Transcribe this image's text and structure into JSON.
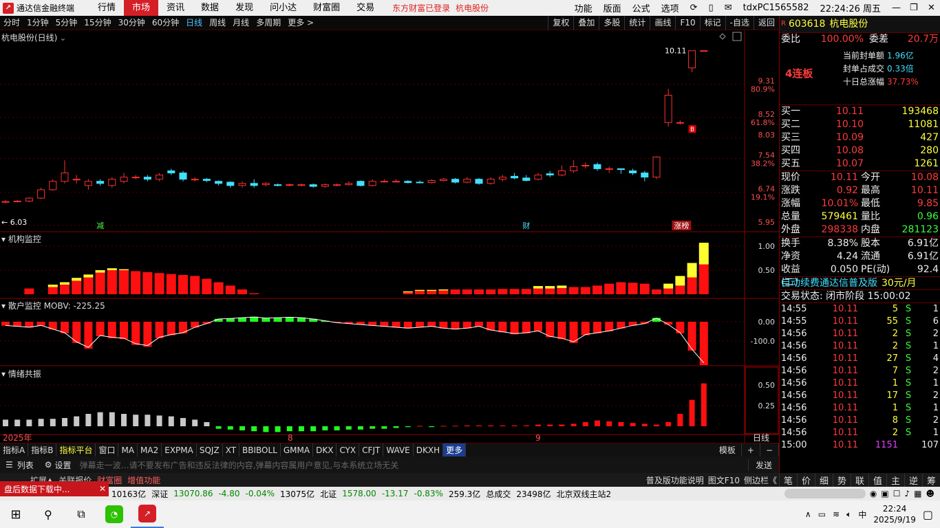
{
  "titlebar": {
    "app": "通达信金融终端",
    "menus": [
      "行情",
      "市场",
      "资讯",
      "数据",
      "发现",
      "问小达",
      "财富圈",
      "交易"
    ],
    "active_menu": "市场",
    "notice1": "东方财富已登录",
    "notice2": "杭电股份",
    "right_menus": [
      "功能",
      "版面",
      "公式",
      "选项"
    ],
    "account": "tdxPC1565582",
    "time": "22:24:26 周五"
  },
  "periods": [
    "分时",
    "1分钟",
    "5分钟",
    "15分钟",
    "30分钟",
    "60分钟",
    "日线",
    "周线",
    "月线",
    "多周期",
    "更多 >"
  ],
  "active_period": "日线",
  "toolbtns": [
    "复权",
    "叠加",
    "多股",
    "统计",
    "画线",
    "F10",
    "标记",
    "-自选",
    "返回"
  ],
  "chart": {
    "title": "杭电股份(日线)",
    "high_label": "10.11",
    "low_label": "← 6.03",
    "axis_prices": [
      "9.31",
      "8.52",
      "8.03",
      "7.54",
      "6.74",
      "5.95"
    ],
    "axis_pcts": [
      "80.9%",
      "61.8%",
      "38.2%",
      "19.1%"
    ],
    "markers": {
      "jian": "减",
      "cai": "财",
      "zhangbang": "涨榜",
      "b": "B"
    }
  },
  "panels": {
    "jigou": {
      "label": "机构监控",
      "ticks": [
        "1.00",
        "0.50"
      ]
    },
    "sanhu": {
      "label": "散户监控",
      "value": "MOBV: -225.25",
      "ticks": [
        "0.00",
        "-100.0"
      ]
    },
    "qingxu": {
      "label": "情绪共振",
      "ticks": [
        "0.50",
        "0.25"
      ]
    }
  },
  "xaxis": {
    "year": "2025年",
    "m8": "8",
    "m9": "9",
    "period": "日线"
  },
  "chart_data": {
    "type": "candlestick",
    "candles": [
      [
        6.5,
        6.52,
        6.55,
        6.48
      ],
      [
        6.52,
        6.53,
        6.56,
        6.5
      ],
      [
        6.53,
        6.6,
        6.62,
        6.5
      ],
      [
        6.6,
        6.8,
        6.85,
        6.58
      ],
      [
        6.8,
        7.0,
        7.05,
        6.78
      ],
      [
        7.0,
        7.2,
        7.5,
        6.95
      ],
      [
        7.05,
        7.05,
        7.15,
        6.95
      ],
      [
        6.9,
        7.0,
        7.05,
        6.8
      ],
      [
        7.0,
        6.95,
        7.05,
        6.9
      ],
      [
        6.9,
        7.05,
        7.1,
        6.85
      ],
      [
        7.0,
        7.1,
        7.2,
        6.95
      ],
      [
        7.1,
        7.1,
        7.15,
        7.05
      ],
      [
        7.1,
        7.05,
        7.15,
        7.0
      ],
      [
        7.05,
        7.15,
        7.2,
        7.0
      ],
      [
        7.25,
        7.2,
        7.3,
        7.15
      ],
      [
        7.2,
        7.05,
        7.25,
        7.0
      ],
      [
        7.05,
        7.05,
        7.1,
        7.0
      ],
      [
        7.05,
        7.02,
        7.08,
        6.98
      ],
      [
        7.0,
        6.95,
        7.02,
        6.9
      ],
      [
        6.98,
        6.9,
        7.0,
        6.85
      ],
      [
        6.9,
        6.95,
        7.0,
        6.85
      ],
      [
        6.95,
        6.9,
        7.05,
        6.85
      ],
      [
        6.92,
        6.95,
        6.98,
        6.88
      ],
      [
        6.92,
        6.9,
        6.95,
        6.88
      ],
      [
        6.92,
        6.92,
        6.95,
        6.88
      ],
      [
        6.9,
        6.92,
        6.95,
        6.88
      ],
      [
        6.92,
        6.88,
        6.95,
        6.85
      ],
      [
        6.88,
        6.92,
        6.95,
        6.85
      ],
      [
        6.9,
        6.92,
        6.95,
        6.88
      ],
      [
        6.92,
        6.95,
        7.0,
        6.9
      ],
      [
        7.0,
        6.9,
        7.02,
        6.88
      ],
      [
        6.9,
        7.0,
        7.05,
        6.88
      ],
      [
        7.0,
        7.0,
        7.05,
        6.98
      ],
      [
        7.0,
        7.0,
        7.05,
        6.98
      ],
      [
        7.0,
        6.97,
        7.03,
        6.95
      ],
      [
        6.98,
        6.97,
        7.02,
        6.95
      ],
      [
        6.97,
        7.02,
        7.05,
        6.95
      ],
      [
        7.02,
        7.05,
        7.08,
        7.0
      ],
      [
        7.05,
        6.98,
        7.08,
        6.95
      ],
      [
        6.98,
        7.05,
        7.1,
        6.95
      ],
      [
        7.05,
        6.95,
        7.08,
        6.92
      ],
      [
        6.95,
        7.05,
        7.1,
        6.92
      ],
      [
        7.05,
        7.1,
        7.15,
        7.0
      ],
      [
        7.12,
        7.08,
        7.2,
        7.05
      ],
      [
        7.08,
        7.02,
        7.15,
        7.0
      ],
      [
        7.05,
        7.15,
        7.2,
        7.02
      ],
      [
        7.18,
        7.15,
        7.25,
        7.1
      ],
      [
        7.15,
        7.25,
        7.38,
        7.12
      ],
      [
        7.25,
        7.35,
        7.5,
        7.2
      ],
      [
        7.38,
        7.38,
        7.45,
        7.3
      ],
      [
        7.4,
        7.3,
        7.45,
        7.25
      ],
      [
        7.3,
        7.3,
        7.35,
        7.2
      ],
      [
        7.3,
        7.28,
        7.3,
        7.18
      ],
      [
        7.25,
        7.2,
        7.3,
        7.15
      ],
      [
        7.2,
        7.1,
        7.25,
        7.0
      ],
      [
        7.1,
        7.58,
        7.6,
        7.05
      ],
      [
        8.4,
        9.05,
        9.2,
        8.3
      ],
      [
        8.4,
        8.4,
        8.45,
        8.35
      ],
      [
        9.7,
        10.11,
        10.11,
        9.6
      ],
      [
        10.11,
        10.11,
        10.11,
        10.11
      ]
    ],
    "jigou": {
      "red": [
        0,
        0,
        0.12,
        0,
        0.15,
        0.2,
        0.28,
        0.35,
        0.45,
        0.5,
        0.5,
        0.48,
        0.46,
        0.44,
        0.42,
        0.4,
        0.38,
        0.32,
        0.25,
        0.18,
        0.1,
        0.02,
        0,
        0,
        0,
        0,
        0,
        0,
        0,
        0,
        0,
        0,
        0,
        0,
        0.04,
        0.07,
        0.07,
        0.08,
        0.1,
        0.1,
        0.1,
        0.1,
        0.11,
        0.11,
        0.11,
        0.12,
        0.12,
        0.13,
        0.15,
        0.15,
        0.18,
        0.22,
        0.25,
        0.24,
        0.22,
        0.1,
        0.12,
        0.18,
        0.35,
        0.62
      ],
      "yellow": [
        0,
        0,
        0,
        0,
        0.05,
        0.05,
        0.06,
        0.06,
        0.05,
        0.04,
        0.02,
        0,
        0,
        0,
        0,
        0,
        0,
        0,
        0,
        0,
        0,
        0,
        0,
        0,
        0,
        0,
        0,
        0,
        0,
        0,
        0,
        0,
        0,
        0,
        0.02,
        0.02,
        0.02,
        0.02,
        0,
        0,
        0,
        0,
        0,
        0,
        0,
        0.05,
        0.05,
        0.05,
        0,
        0,
        0,
        0,
        0,
        0,
        0,
        0,
        0.1,
        0.2,
        0.3,
        0.45
      ]
    },
    "sanhu": [
      -20,
      -25,
      -30,
      -20,
      -40,
      -60,
      -110,
      -140,
      -75,
      -85,
      -90,
      -120,
      -130,
      -85,
      -70,
      -60,
      -30,
      -10,
      15,
      18,
      22,
      26,
      20,
      22,
      25,
      22,
      15,
      5,
      -5,
      -10,
      -15,
      -20,
      -25,
      -30,
      -35,
      -30,
      -25,
      -35,
      -40,
      -35,
      -25,
      -45,
      -55,
      -65,
      -60,
      -50,
      -80,
      -90,
      -110,
      -70,
      -60,
      -50,
      -35,
      -20,
      -10,
      20,
      -15,
      -60,
      -150,
      -225
    ],
    "qingxu": [
      0.08,
      0.08,
      0.08,
      0.09,
      0.09,
      0.1,
      0.12,
      0.15,
      0.17,
      0.17,
      0.15,
      0.14,
      0.14,
      0.13,
      0.12,
      0.1,
      0.08,
      0.05,
      -0.03,
      -0.04,
      -0.05,
      -0.06,
      -0.07,
      -0.07,
      -0.06,
      -0.06,
      -0.06,
      -0.05,
      -0.05,
      -0.04,
      -0.04,
      -0.03,
      -0.03,
      -0.02,
      -0.01,
      0.005,
      -0.01,
      0.005,
      0.005,
      0.01,
      0.01,
      0.01,
      0.01,
      0.01,
      0.01,
      0.02,
      0.02,
      0.02,
      0.03,
      0.05,
      0.07,
      0.06,
      0.05,
      0.04,
      0.03,
      0.02,
      0.05,
      0.15,
      0.32,
      0.52
    ]
  },
  "stock": {
    "code": "603618",
    "name": "杭电股份",
    "r": "R",
    "weibi_label": "委比",
    "weibi": "100.00%",
    "weicha_label": "委差",
    "weicha": "20.7万",
    "lianban": "4连板",
    "info": [
      {
        "k": "当前封单额",
        "v": "1.96亿"
      },
      {
        "k": "封单占成交",
        "v": "0.33倍"
      },
      {
        "k": "十日总涨幅",
        "v": "37.73%"
      }
    ],
    "bids": [
      {
        "k": "买一",
        "p": "10.11",
        "v": "193468"
      },
      {
        "k": "买二",
        "p": "10.10",
        "v": "11081"
      },
      {
        "k": "买三",
        "p": "10.09",
        "v": "427"
      },
      {
        "k": "买四",
        "p": "10.08",
        "v": "280"
      },
      {
        "k": "买五",
        "p": "10.07",
        "v": "1261"
      }
    ],
    "quote": [
      {
        "k1": "现价",
        "v1": "10.11",
        "k2": "今开",
        "v2": "10.08"
      },
      {
        "k1": "涨跌",
        "v1": "0.92",
        "k2": "最高",
        "v2": "10.11"
      },
      {
        "k1": "涨幅",
        "v1": "10.01%",
        "k2": "最低",
        "v2": "9.85"
      },
      {
        "k1": "总量",
        "v1": "579461",
        "k2": "量比",
        "v2": "0.96"
      },
      {
        "k1": "外盘",
        "v1": "298338",
        "k2": "内盘",
        "v2": "281123"
      }
    ],
    "fund": [
      {
        "k1": "换手",
        "v1": "8.38%",
        "k2": "股本",
        "v2": "6.91亿"
      },
      {
        "k1": "净资",
        "v1": "4.24",
        "k2": "流通",
        "v2": "6.91亿"
      },
      {
        "k1": "收益(二)",
        "v1": "0.050",
        "k2": "PE(动)",
        "v2": "92.4"
      }
    ],
    "ad": "自动续费通达信普及版",
    "ad_price": "30元/月",
    "state": "交易状态: 闭市阶段 15:00:02",
    "ticks": [
      {
        "t": "14:55",
        "p": "10.11",
        "v": "5",
        "s": "S",
        "n": "1"
      },
      {
        "t": "14:55",
        "p": "10.11",
        "v": "55",
        "s": "S",
        "n": "6"
      },
      {
        "t": "14:56",
        "p": "10.11",
        "v": "2",
        "s": "S",
        "n": "2"
      },
      {
        "t": "14:56",
        "p": "10.11",
        "v": "2",
        "s": "S",
        "n": "1"
      },
      {
        "t": "14:56",
        "p": "10.11",
        "v": "27",
        "s": "S",
        "n": "4"
      },
      {
        "t": "14:56",
        "p": "10.11",
        "v": "7",
        "s": "S",
        "n": "2"
      },
      {
        "t": "14:56",
        "p": "10.11",
        "v": "1",
        "s": "S",
        "n": "1"
      },
      {
        "t": "14:56",
        "p": "10.11",
        "v": "17",
        "s": "S",
        "n": "2"
      },
      {
        "t": "14:56",
        "p": "10.11",
        "v": "1",
        "s": "S",
        "n": "1"
      },
      {
        "t": "14:56",
        "p": "10.11",
        "v": "8",
        "s": "S",
        "n": "2"
      },
      {
        "t": "14:56",
        "p": "10.11",
        "v": "2",
        "s": "S",
        "n": "1"
      },
      {
        "t": "15:00",
        "p": "10.11",
        "v": "1151",
        "s": "",
        "n": "107"
      }
    ]
  },
  "indtabs": [
    "指标A",
    "指标B",
    "指标平台",
    "窗口",
    "MA",
    "MA2",
    "EXPMA",
    "SQJZ",
    "XT",
    "BBIBOLL",
    "GMMA",
    "DKX",
    "CYX",
    "CFJT",
    "WAVE",
    "DKXH",
    "更多"
  ],
  "indtabs_right": [
    "模板",
    "+",
    "−"
  ],
  "bottom": {
    "list": "列表",
    "settings": "设置",
    "barrage": "弹幕走一波…请不要发布广告和违反法律的内容,弹幕内容属用户意见,与本系统立场无关",
    "send": "发送"
  },
  "footer": {
    "tabs": [
      "扩展▲",
      "关联报价",
      "财富圈",
      "增值功能"
    ],
    "right": [
      "普及版功能说明",
      "图文F10",
      "侧边栏《"
    ],
    "side": [
      "笔",
      "价",
      "细",
      "势",
      "联",
      "值",
      "主",
      "逆",
      "筹"
    ]
  },
  "popup": "盘后数据下载中...",
  "status": {
    "items": [
      "10163亿",
      "深证",
      "13070.86",
      "-4.80",
      "-0.04%",
      "13075亿",
      "北证",
      "1578.00",
      "-13.17",
      "-0.83%",
      "259.3亿",
      "总成交",
      "23498亿",
      "北京双线主站2"
    ],
    "pct0": "%"
  },
  "taskbar": {
    "time": "22:24",
    "date": "2025/9/19",
    "ime": "中"
  }
}
